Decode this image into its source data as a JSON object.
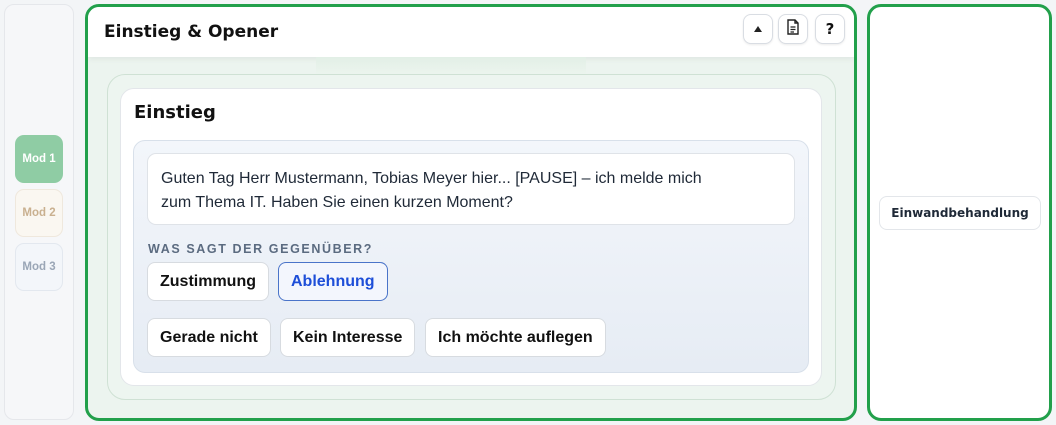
{
  "rail": {
    "modules": [
      {
        "label": "Mod 1",
        "state": "active",
        "color": "#8fcca4"
      },
      {
        "label": "Mod 2",
        "state": "inactive",
        "color": "#c9b08f"
      },
      {
        "label": "Mod 3",
        "state": "inactive",
        "color": "#9aa6b6"
      }
    ]
  },
  "main": {
    "title": "Einstieg & Opener",
    "accent_color": "#22a04b",
    "header_buttons": [
      {
        "icon": "chevron-up-icon"
      },
      {
        "icon": "document-icon"
      },
      {
        "icon": "help-icon",
        "label": "?"
      }
    ],
    "section": {
      "title": "Einstieg",
      "script_lines": [
        "Guten Tag Herr Mustermann, Tobias Meyer hier... [PAUSE] – ich melde mich",
        "zum Thema IT. Haben Sie einen kurzen Moment?"
      ],
      "question_label": "WAS SAGT DER GEGENÜBER?",
      "answers_primary": [
        {
          "label": "Zustimmung",
          "selected": false
        },
        {
          "label": "Ablehnung",
          "selected": true
        }
      ],
      "answers_secondary": [
        {
          "label": "Gerade nicht"
        },
        {
          "label": "Kein Interesse"
        },
        {
          "label": "Ich möchte auflegen"
        }
      ],
      "selected_color": "#1d4ed8"
    }
  },
  "side": {
    "chip_label": "Einwandbehandlung"
  }
}
